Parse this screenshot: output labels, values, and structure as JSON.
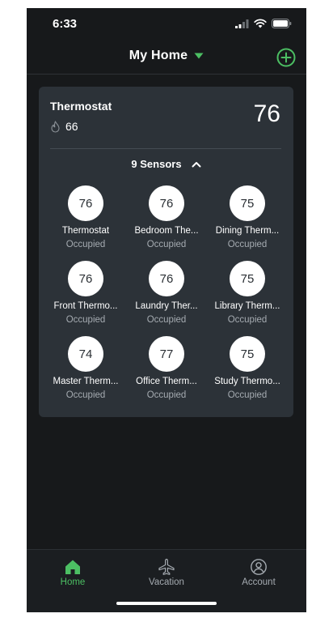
{
  "status_bar": {
    "time": "6:33"
  },
  "header": {
    "home_name": "My Home",
    "add_icon": "plus-circle-icon",
    "dropdown_icon": "caret-down-icon"
  },
  "thermostat_card": {
    "title": "Thermostat",
    "setpoint": "66",
    "setpoint_icon": "flame-icon",
    "current_temp": "76",
    "sensors_label": "9 Sensors",
    "sensors_expanded": true,
    "sensors": [
      {
        "temp": "76",
        "name": "Thermostat",
        "status": "Occupied"
      },
      {
        "temp": "76",
        "name": "Bedroom The...",
        "status": "Occupied"
      },
      {
        "temp": "75",
        "name": "Dining Therm...",
        "status": "Occupied"
      },
      {
        "temp": "76",
        "name": "Front Thermo...",
        "status": "Occupied"
      },
      {
        "temp": "76",
        "name": "Laundry Ther...",
        "status": "Occupied"
      },
      {
        "temp": "75",
        "name": "Library Therm...",
        "status": "Occupied"
      },
      {
        "temp": "74",
        "name": "Master Therm...",
        "status": "Occupied"
      },
      {
        "temp": "77",
        "name": "Office Therm...",
        "status": "Occupied"
      },
      {
        "temp": "75",
        "name": "Study Thermo...",
        "status": "Occupied"
      }
    ]
  },
  "bottom_nav": {
    "items": [
      {
        "label": "Home",
        "icon": "home-icon",
        "active": true
      },
      {
        "label": "Vacation",
        "icon": "airplane-icon",
        "active": false
      },
      {
        "label": "Account",
        "icon": "account-icon",
        "active": false
      }
    ]
  },
  "colors": {
    "accent": "#4cbf63",
    "background": "#17191b",
    "card": "#2c3238",
    "inactive": "#a5abb1"
  }
}
